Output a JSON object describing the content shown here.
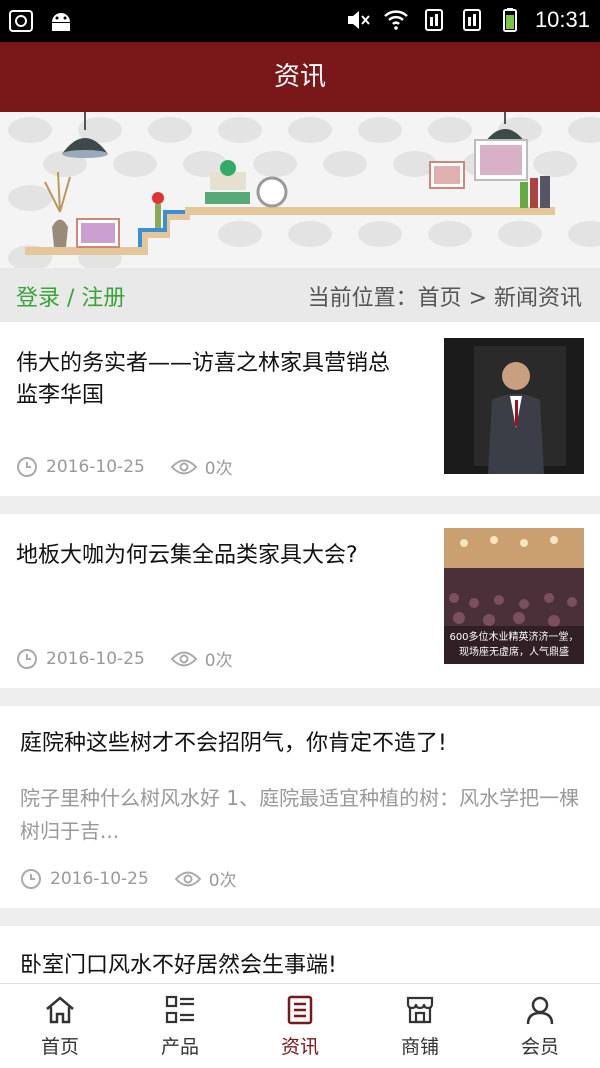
{
  "status_bar": {
    "time": "10:31"
  },
  "header": {
    "title": "资讯"
  },
  "crumbs": {
    "login": "登录 / 注册",
    "location": "当前位置：首页 > 新闻资讯"
  },
  "articles": [
    {
      "title": "伟大的务实者——访喜之林家具营销总监李华国",
      "date": "2016-10-25",
      "views": "0次"
    },
    {
      "title": "地板大咖为何云集全品类家具大会?",
      "date": "2016-10-25",
      "views": "0次",
      "image_caption": "600多位木业精英济济一堂，现场座无虚席，人气鼎盛"
    },
    {
      "title": "庭院种这些树才不会招阴气，你肯定不造了!",
      "summary": "院子里种什么树风水好 1、庭院最适宜种植的树：风水学把一棵树归于吉...",
      "date": "2016-10-25",
      "views": "0次"
    },
    {
      "title": "卧室门口风水不好居然会生事端!"
    }
  ],
  "tabs": [
    {
      "label": "首页",
      "icon": "home-icon"
    },
    {
      "label": "产品",
      "icon": "list-grid-icon"
    },
    {
      "label": "资讯",
      "icon": "news-icon"
    },
    {
      "label": "商铺",
      "icon": "shop-icon"
    },
    {
      "label": "会员",
      "icon": "user-icon"
    }
  ],
  "colors": {
    "brand": "#7a1718",
    "login_green": "#3aa33a",
    "meta_gray": "#999999"
  }
}
